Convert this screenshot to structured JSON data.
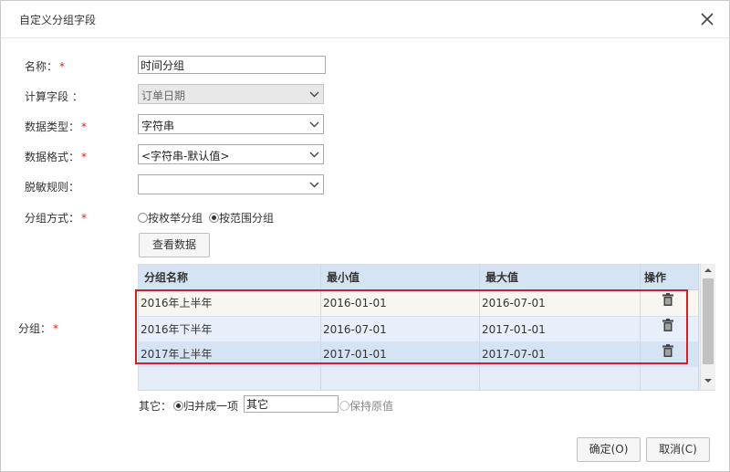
{
  "dialog": {
    "title": "自定义分组字段"
  },
  "form": {
    "name_label": "名称：",
    "name_value": "时间分组",
    "calc_field_label": "计算字段 ：",
    "calc_field_value": "订单日期",
    "data_type_label": "数据类型：",
    "data_type_value": "字符串",
    "data_format_label": "数据格式：",
    "data_format_value": "<字符串-默认值>",
    "masking_label": "脱敏规则：",
    "masking_value": "",
    "group_mode_label": "分组方式：",
    "group_mode_options": [
      "按枚举分组",
      "按范围分组"
    ],
    "group_mode_selected": "按范围分组",
    "view_data_button": "查看数据",
    "group_label": "分组：",
    "required_mark": "*"
  },
  "grid": {
    "columns": [
      "分组名称",
      "最小值",
      "最大值",
      "操作"
    ],
    "rows": [
      {
        "name": "2016年上半年",
        "min": "2016-01-01",
        "max": "2016-07-01"
      },
      {
        "name": "2016年下半年",
        "min": "2016-07-01",
        "max": "2017-01-01"
      },
      {
        "name": "2017年上半年",
        "min": "2017-01-01",
        "max": "2017-07-01"
      }
    ],
    "action_icon": "trash-icon"
  },
  "other": {
    "label": "其它：",
    "merge_option": "归并成一项",
    "merge_value": "其它",
    "keep_option": "保持原值"
  },
  "buttons": {
    "ok": "确定(O)",
    "cancel": "取消(C)"
  },
  "colors": {
    "required": "#e02020",
    "highlight": "#d0202a",
    "grid_header": "#d6e3f2"
  }
}
